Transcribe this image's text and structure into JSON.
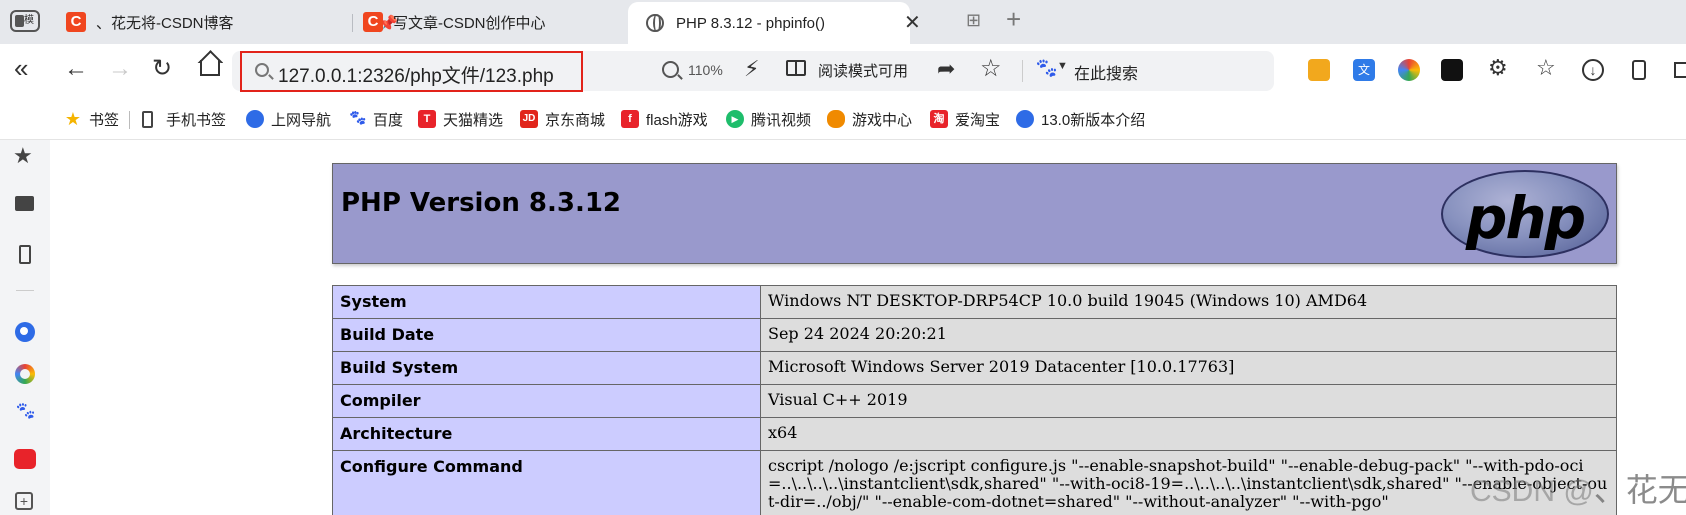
{
  "tabs": [
    {
      "favicon": "C",
      "title": "、花无将-CSDN博客"
    },
    {
      "favicon": "C",
      "title": "写文章-CSDN创作中心"
    },
    {
      "title": "PHP 8.3.12 - phpinfo()",
      "active": true
    }
  ],
  "toolbar": {
    "url": "127.0.0.1:2326/php文件/123.php",
    "zoom": "110%",
    "reader_mode": "阅读模式可用",
    "search_placeholder": "在此搜索"
  },
  "tab_menu_label": "模",
  "bookmarks": [
    {
      "label": "书签",
      "icon": "star-icon",
      "color": "#f5b400"
    },
    {
      "label": "手机书签",
      "icon": "phone-icon",
      "color": "#444444"
    },
    {
      "label": "上网导航",
      "icon": "q-icon",
      "color": "#2e6be6"
    },
    {
      "label": "百度",
      "icon": "paw-icon",
      "color": "#2f5bea"
    },
    {
      "label": "天猫精选",
      "icon": "tmall-icon",
      "color": "#e8232a"
    },
    {
      "label": "京东商城",
      "icon": "jd-icon",
      "color": "#e1251b"
    },
    {
      "label": "flash游戏",
      "icon": "flash-icon",
      "color": "#e8232a"
    },
    {
      "label": "腾讯视频",
      "icon": "video-icon",
      "color": "#1ebd6b"
    },
    {
      "label": "游戏中心",
      "icon": "gamepad-icon",
      "color": "#f08a00"
    },
    {
      "label": "爱淘宝",
      "icon": "taobao-icon",
      "color": "#e8232a"
    },
    {
      "label": "13.0新版本介绍",
      "icon": "q-icon",
      "color": "#2e6be6"
    }
  ],
  "phpinfo": {
    "version_title": "PHP Version 8.3.12",
    "logo_text": "php",
    "rows": [
      {
        "key": "System",
        "value": "Windows NT DESKTOP-DRP54CP 10.0 build 19045 (Windows 10) AMD64"
      },
      {
        "key": "Build Date",
        "value": "Sep 24 2024 20:20:21"
      },
      {
        "key": "Build System",
        "value": "Microsoft Windows Server 2019 Datacenter [10.0.17763]"
      },
      {
        "key": "Compiler",
        "value": "Visual C++ 2019"
      },
      {
        "key": "Architecture",
        "value": "x64"
      },
      {
        "key": "Configure Command",
        "value": "cscript /nologo /e:jscript configure.js \"--enable-snapshot-build\" \"--enable-debug-pack\" \"--with-pdo-oci=..\\..\\..\\..\\instantclient\\sdk,shared\" \"--with-oci8-19=..\\..\\..\\..\\instantclient\\sdk,shared\" \"--enable-object-out-dir=../obj/\" \"--enable-com-dotnet=shared\" \"--without-analyzer\" \"--with-pgo\""
      }
    ]
  },
  "watermark": {
    "prefix": "CSDN @",
    "name": "、花无将"
  }
}
